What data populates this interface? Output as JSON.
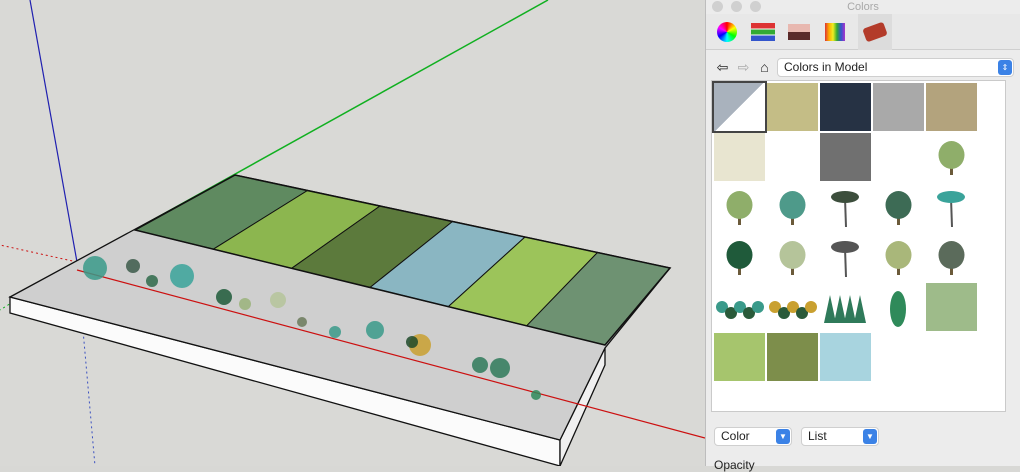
{
  "panel": {
    "title": "Colors",
    "toolbar": [
      {
        "name": "color-wheel-icon"
      },
      {
        "name": "color-sliders-icon"
      },
      {
        "name": "color-palettes-icon"
      },
      {
        "name": "image-palette-icon"
      },
      {
        "name": "materials-brick-icon"
      }
    ],
    "collection": "Colors in Model",
    "nav": {
      "back": "⇦",
      "forward": "⇨",
      "home": "⌂"
    },
    "materials": [
      {
        "kind": "split",
        "color": "#a9b2bd"
      },
      {
        "kind": "color",
        "color": "#c4bd86"
      },
      {
        "kind": "color",
        "color": "#263244"
      },
      {
        "kind": "color",
        "color": "#a9a9a9"
      },
      {
        "kind": "color",
        "color": "#b3a37d"
      },
      {
        "kind": "color",
        "color": "#e8e5d0"
      },
      {
        "kind": "empty"
      },
      {
        "kind": "color",
        "color": "#707070"
      },
      {
        "kind": "empty"
      },
      {
        "kind": "tree",
        "color": "#8fae6a"
      },
      {
        "kind": "tree",
        "color": "#8fae6a"
      },
      {
        "kind": "tree",
        "color": "#4e9a8a"
      },
      {
        "kind": "palm",
        "color": "#3c4e3c"
      },
      {
        "kind": "tree",
        "color": "#3d6b55"
      },
      {
        "kind": "palm",
        "color": "#3aa39a"
      },
      {
        "kind": "tree",
        "color": "#1f5a3a"
      },
      {
        "kind": "tree",
        "color": "#b5c49a"
      },
      {
        "kind": "palm",
        "color": "#555"
      },
      {
        "kind": "tree",
        "color": "#a9b77a"
      },
      {
        "kind": "tree",
        "color": "#5b6b5b"
      },
      {
        "kind": "group",
        "color": "#3a9a8a"
      },
      {
        "kind": "group",
        "color": "#c9a030"
      },
      {
        "kind": "pines",
        "color": "#2f7a5a"
      },
      {
        "kind": "cypress",
        "color": "#2f8a5a"
      },
      {
        "kind": "texture",
        "color": "#9ebb8a"
      },
      {
        "kind": "texture",
        "color": "#a6c56d"
      },
      {
        "kind": "texture",
        "color": "#7d8e4b"
      },
      {
        "kind": "texture",
        "color": "#a8d4df"
      }
    ],
    "mode_select": "Color",
    "view_select": "List",
    "opacity_label": "Opacity"
  },
  "scene": {
    "strip_colors": [
      "#5f8a60",
      "#8cb64f",
      "#5c7a3c",
      "#8ab6c2",
      "#9cc45a",
      "#6e9272"
    ],
    "axis_colors": {
      "x": "#cc1010",
      "y": "#10b020",
      "z": "#2020b0"
    }
  }
}
